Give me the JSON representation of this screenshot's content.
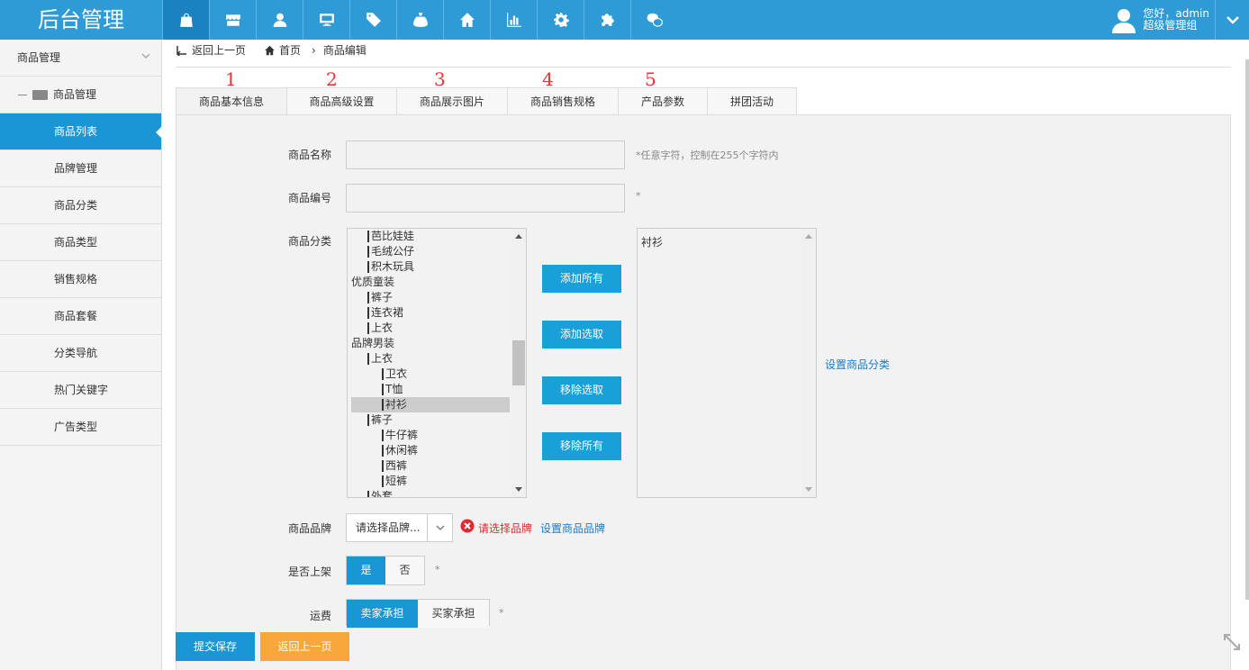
{
  "app": {
    "title": "后台管理"
  },
  "topnav": {
    "icons": [
      "shopping-bag-icon",
      "store-icon",
      "user-icon",
      "monitor-icon",
      "tag-icon",
      "money-bag-icon",
      "home-icon",
      "bar-chart-icon",
      "gear-icon",
      "puzzle-icon",
      "wechat-icon"
    ]
  },
  "user": {
    "greeting": "您好，admin",
    "role": "超级管理组"
  },
  "sidebar": {
    "header": "商品管理",
    "group": "商品管理",
    "items": [
      "商品列表",
      "品牌管理",
      "商品分类",
      "商品类型",
      "销售规格",
      "商品套餐",
      "分类导航",
      "热门关键字",
      "广告类型"
    ],
    "active": "商品列表"
  },
  "breadcrumb": {
    "back": "返回上一页",
    "home": "首页",
    "current": "商品编辑"
  },
  "tab_numbers": [
    "1",
    "2",
    "3",
    "4",
    "5"
  ],
  "tabs": [
    "商品基本信息",
    "商品高级设置",
    "商品展示图片",
    "商品销售规格",
    "产品参数",
    "拼团活动"
  ],
  "form": {
    "name_label": "商品名称",
    "name_hint": "*任意字符，控制在255个字符内",
    "code_label": "商品编号",
    "code_hint": "*",
    "category_label": "商品分类",
    "category_tree": [
      {
        "text": "芭比娃娃",
        "level": 1
      },
      {
        "text": "毛绒公仔",
        "level": 1
      },
      {
        "text": "积木玩具",
        "level": 1
      },
      {
        "text": "优质童装",
        "level": 0
      },
      {
        "text": "裤子",
        "level": 1
      },
      {
        "text": "连衣裙",
        "level": 1
      },
      {
        "text": "上衣",
        "level": 1
      },
      {
        "text": "品牌男装",
        "level": 0
      },
      {
        "text": "上衣",
        "level": 1
      },
      {
        "text": "卫衣",
        "level": 2
      },
      {
        "text": "T恤",
        "level": 2
      },
      {
        "text": "衬衫",
        "level": 2,
        "selected": true
      },
      {
        "text": "裤子",
        "level": 1
      },
      {
        "text": "牛仔裤",
        "level": 2
      },
      {
        "text": "休闲裤",
        "level": 2
      },
      {
        "text": "西裤",
        "level": 2
      },
      {
        "text": "短裤",
        "level": 2
      },
      {
        "text": "外套",
        "level": 1
      }
    ],
    "btn_add_all": "添加所有",
    "btn_add_selected": "添加选取",
    "btn_remove_selected": "移除选取",
    "btn_remove_all": "移除所有",
    "selected_categories": [
      "衬衫"
    ],
    "set_category_link": "设置商品分类",
    "brand_label": "商品品牌",
    "brand_placeholder": "请选择品牌...",
    "brand_error": "请选择品牌",
    "set_brand_link": "设置商品品牌",
    "onsale_label": "是否上架",
    "onsale_yes": "是",
    "onsale_no": "否",
    "onsale_hint": "*",
    "shipping_label": "运费",
    "shipping_seller": "卖家承担",
    "shipping_buyer": "买家承担",
    "shipping_hint": "*"
  },
  "footer": {
    "submit": "提交保存",
    "back": "返回上一页"
  }
}
